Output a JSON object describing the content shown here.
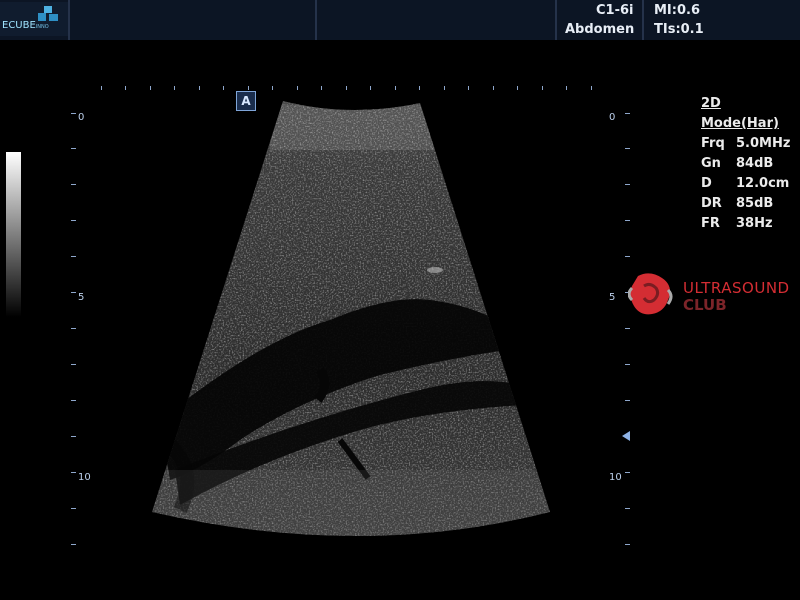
{
  "header": {
    "logo_text": "ECUBE",
    "logo_subtext": "INNO",
    "probe": "C1-6i",
    "preset": "Abdomen",
    "mi": "MI:0.6",
    "tis": "TIs:0.1"
  },
  "depth_scale": {
    "left_labels": [
      "0",
      "5",
      "10"
    ],
    "right_labels": [
      "0",
      "5",
      "10"
    ]
  },
  "params": {
    "title": "2D Mode(Har)",
    "rows": [
      {
        "key": "Frq",
        "value": "5.0MHz"
      },
      {
        "key": "Gn",
        "value": "84dB"
      },
      {
        "key": "D",
        "value": "12.0cm"
      },
      {
        "key": "DR",
        "value": "85dB"
      },
      {
        "key": "FR",
        "value": "38Hz"
      }
    ]
  },
  "mode_icon": "A",
  "watermark": {
    "line1": "ULTRASOUND",
    "line2": "CLUB",
    "icon": "ultrasound-club-logo-icon",
    "colors": {
      "primary": "#d42d33",
      "secondary": "#7c2429"
    }
  },
  "colors": {
    "topbar": "#0c1524",
    "scale": "#8ea7cc",
    "background": "#000000"
  }
}
